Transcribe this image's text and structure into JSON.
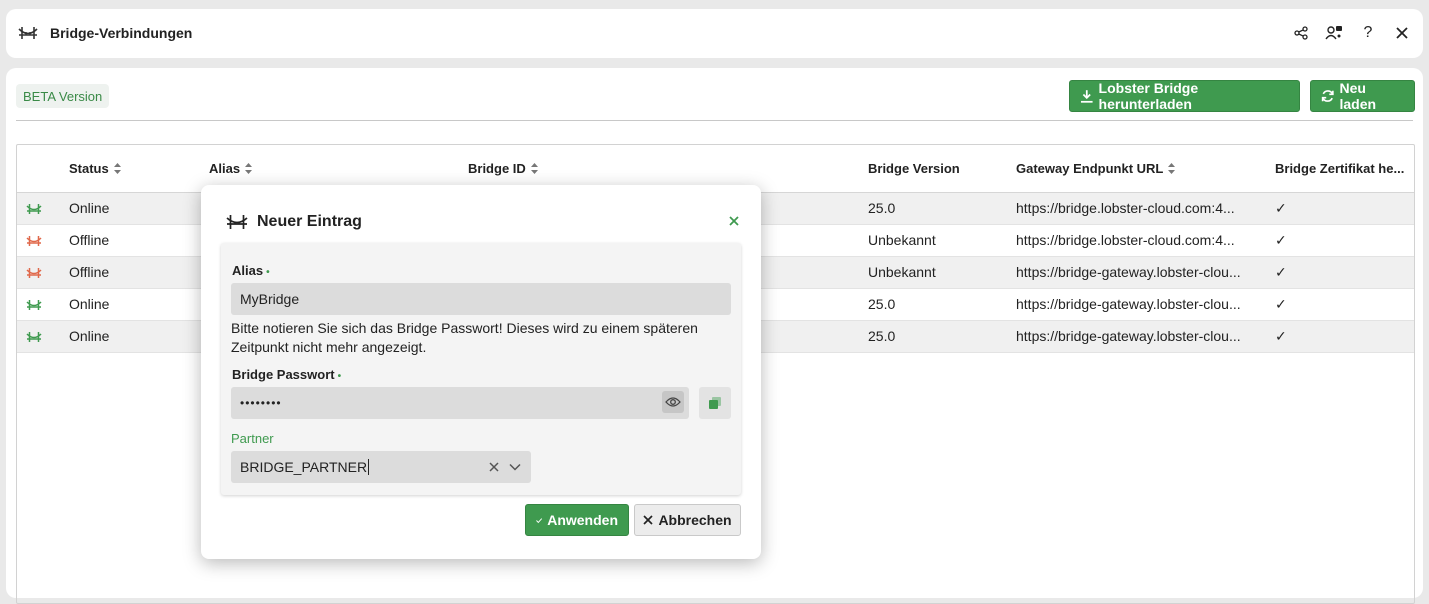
{
  "window": {
    "title": "Bridge-Verbindungen",
    "share_icon": "share-icon",
    "users_icon": "user-group-icon",
    "help_label": "?",
    "close_icon": "close-icon"
  },
  "toolbar": {
    "beta_label": "BETA Version",
    "download_label": "Lobster Bridge herunterladen",
    "reload_label": "Neu laden"
  },
  "table": {
    "columns": [
      "Status",
      "Alias",
      "Bridge ID",
      "Bridge Version",
      "Gateway Endpunkt URL",
      "Bridge Zertifikat he..."
    ],
    "rows": [
      {
        "status": "Online",
        "version": "25.0",
        "url": "https://bridge.lobster-cloud.com:4...",
        "cert": "✓"
      },
      {
        "status": "Offline",
        "version": "Unbekannt",
        "url": "https://bridge.lobster-cloud.com:4...",
        "cert": "✓"
      },
      {
        "status": "Offline",
        "version": "Unbekannt",
        "url": "https://bridge-gateway.lobster-clou...",
        "cert": "✓"
      },
      {
        "status": "Online",
        "version": "25.0",
        "url": "https://bridge-gateway.lobster-clou...",
        "cert": "✓"
      },
      {
        "status": "Online",
        "version": "25.0",
        "url": "https://bridge-gateway.lobster-clou...",
        "cert": "✓"
      }
    ]
  },
  "modal": {
    "title": "Neuer Eintrag",
    "alias_label": "Alias",
    "alias_value": "MyBridge",
    "hint": "Bitte notieren Sie sich das Bridge Passwort! Dieses wird zu einem späteren Zeitpunkt nicht mehr angezeigt.",
    "password_label": "Bridge Passwort",
    "password_value": "••••••••",
    "partner_label": "Partner",
    "partner_value": "BRIDGE_PARTNER",
    "apply_label": "Anwenden",
    "cancel_label": "Abbrechen",
    "required_mark": "•"
  },
  "colors": {
    "accent": "#3f9a4f",
    "offline": "#e0684a",
    "online": "#3f9a4f"
  }
}
